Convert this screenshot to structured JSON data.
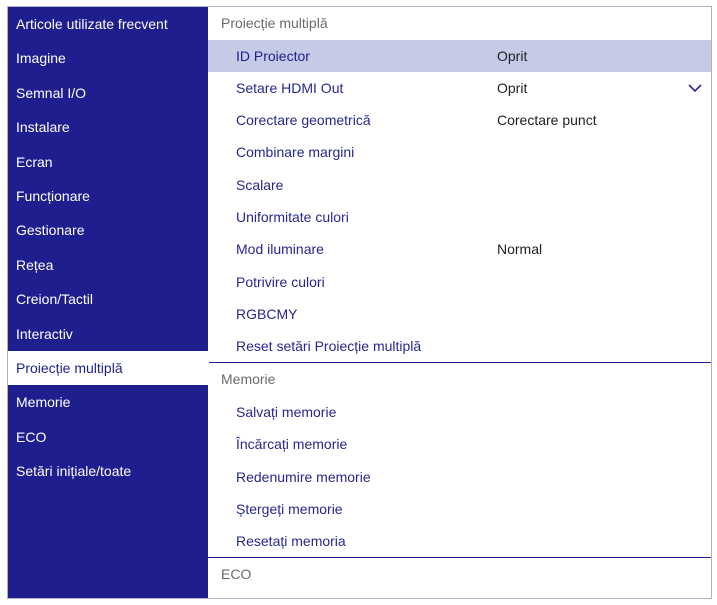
{
  "sidebar": {
    "items": [
      {
        "label": "Articole utilizate frecvent"
      },
      {
        "label": "Imagine"
      },
      {
        "label": "Semnal I/O"
      },
      {
        "label": "Instalare"
      },
      {
        "label": "Ecran"
      },
      {
        "label": "Funcționare"
      },
      {
        "label": "Gestionare"
      },
      {
        "label": "Rețea"
      },
      {
        "label": "Creion/Tactil"
      },
      {
        "label": "Interactiv"
      },
      {
        "label": "Proiecție multiplă"
      },
      {
        "label": "Memorie"
      },
      {
        "label": "ECO"
      },
      {
        "label": "Setări inițiale/toate"
      }
    ],
    "selected_index": 10
  },
  "main": {
    "sections": [
      {
        "header": "Proiecție multiplă",
        "rows": [
          {
            "label": "ID Proiector",
            "value": "Oprit"
          },
          {
            "label": "Setare HDMI Out",
            "value": "Oprit"
          },
          {
            "label": "Corectare geometrică",
            "value": "Corectare punct"
          },
          {
            "label": "Combinare margini",
            "value": ""
          },
          {
            "label": "Scalare",
            "value": ""
          },
          {
            "label": "Uniformitate culori",
            "value": ""
          },
          {
            "label": "Mod iluminare",
            "value": "Normal"
          },
          {
            "label": "Potrivire culori",
            "value": ""
          },
          {
            "label": "RGBCMY",
            "value": ""
          },
          {
            "label": "Reset setări Proiecție multiplă",
            "value": ""
          }
        ]
      },
      {
        "header": "Memorie",
        "rows": [
          {
            "label": "Salvați memorie"
          },
          {
            "label": "Încărcați memorie"
          },
          {
            "label": "Redenumire memorie"
          },
          {
            "label": "Ștergeți memorie"
          },
          {
            "label": "Resetați memoria"
          }
        ]
      },
      {
        "header": "ECO",
        "rows": []
      }
    ],
    "highlighted_row": "ID Proiector",
    "scroll_indicator_icon": "chevron-down-icon"
  },
  "colors": {
    "sidebar_bg": "#1f1e8e",
    "highlight_row": "#c5cae6",
    "label_text": "#27278f"
  }
}
